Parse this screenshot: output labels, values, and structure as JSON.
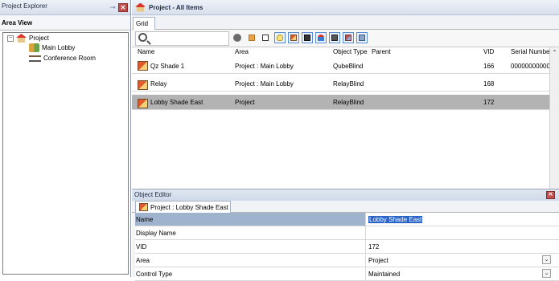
{
  "project_explorer": {
    "title": "Project Explorer",
    "area_view": "Area View",
    "tree": [
      {
        "label": "Project",
        "expander": "⊟",
        "icon": "house-icon"
      },
      {
        "label": "Main Lobby",
        "icon": "lobby-icon"
      },
      {
        "label": "Conference Room",
        "icon": "table-icon"
      }
    ]
  },
  "project_panel": {
    "title": "Project - All Items",
    "tab": "Grid",
    "search": {
      "placeholder": "",
      "value": ""
    },
    "columns": [
      "Name",
      "Area",
      "Object Type",
      "Parent",
      "VID",
      "Serial Numbe"
    ],
    "rows": [
      {
        "name": "Qz Shade 1",
        "area": "Project : Main Lobby",
        "type": "QubeBlind",
        "parent": "",
        "vid": "166",
        "serial": "00000000000("
      },
      {
        "name": "Relay",
        "area": "Project : Main Lobby",
        "type": "RelayBlind",
        "parent": "",
        "vid": "168",
        "serial": ""
      },
      {
        "name": "Lobby Shade East",
        "area": "Project",
        "type": "RelayBlind",
        "parent": "",
        "vid": "172",
        "serial": ""
      }
    ],
    "selected_row": 2
  },
  "object_editor": {
    "title": "Object Editor",
    "tab": "Project : Lobby Shade East",
    "properties": [
      {
        "name": "Name",
        "value": "Lobby Shade East"
      },
      {
        "name": "Display Name",
        "value": ""
      },
      {
        "name": "VID",
        "value": "172"
      },
      {
        "name": "Area",
        "value": "Project"
      },
      {
        "name": "Control Type",
        "value": "Maintained"
      }
    ]
  },
  "colors": {
    "selected_row": "#b3b3b3",
    "selection_blue": "#2a63c7",
    "close_red": "#c0504d"
  }
}
